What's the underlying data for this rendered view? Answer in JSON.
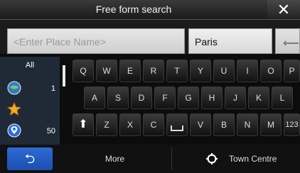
{
  "title": "Free form search",
  "place_input": {
    "placeholder": "<Enter Place Name>"
  },
  "city_input": {
    "value": "Paris"
  },
  "sidebar": [
    {
      "label": "All",
      "icon": "",
      "count": ""
    },
    {
      "label": "",
      "icon": "globe-icon",
      "count": "1"
    },
    {
      "label": "",
      "icon": "star-icon",
      "count": ""
    },
    {
      "label": "",
      "icon": "location-pin-icon",
      "count": "50"
    }
  ],
  "keyboard": {
    "row1": [
      "Q",
      "W",
      "E",
      "R",
      "T",
      "Y",
      "U",
      "I",
      "O",
      "P"
    ],
    "row2": [
      "A",
      "S",
      "D",
      "F",
      "G",
      "H",
      "J",
      "K",
      "L"
    ],
    "row3": [
      "Z",
      "X",
      "C",
      "V",
      "B",
      "N",
      "M"
    ],
    "numbers_key": "123"
  },
  "bottom": {
    "more": "More",
    "town_centre": "Town Centre"
  },
  "colors": {
    "accent_blue": "#2d6bd3",
    "star": "#f4a92a"
  }
}
